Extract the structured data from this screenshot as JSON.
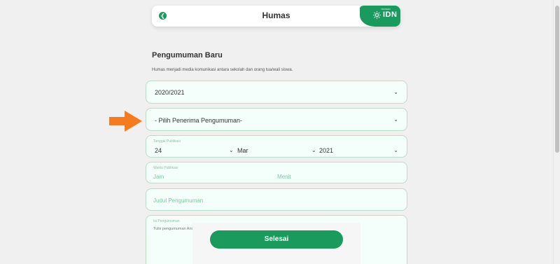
{
  "header": {
    "title": "Humas",
    "logo_small": "YAYASAN",
    "logo_text": "IDN"
  },
  "page": {
    "title": "Pengumuman Baru",
    "description": "Humas menjadi media komunikasi antara sekolah dan orang tua/wali siswa."
  },
  "form": {
    "year": "2020/2021",
    "recipient": "- Pilih Penerima Pengumuman-",
    "publish_date": {
      "label": "Tanggal Publikasi",
      "day": "24",
      "month": "Mar",
      "year": "2021"
    },
    "publish_time": {
      "label": "Waktu Publikasi",
      "hour_placeholder": "Jam",
      "minute_placeholder": "Menit"
    },
    "title_placeholder": "Judul Pengumuman",
    "content": {
      "label": "Isi Pengumuman",
      "placeholder": "Tulis pengumuman Anda di sini"
    }
  },
  "actions": {
    "done_label": "Selesai"
  },
  "colors": {
    "accent": "#1b9a5d",
    "arrow": "#f47b20"
  }
}
